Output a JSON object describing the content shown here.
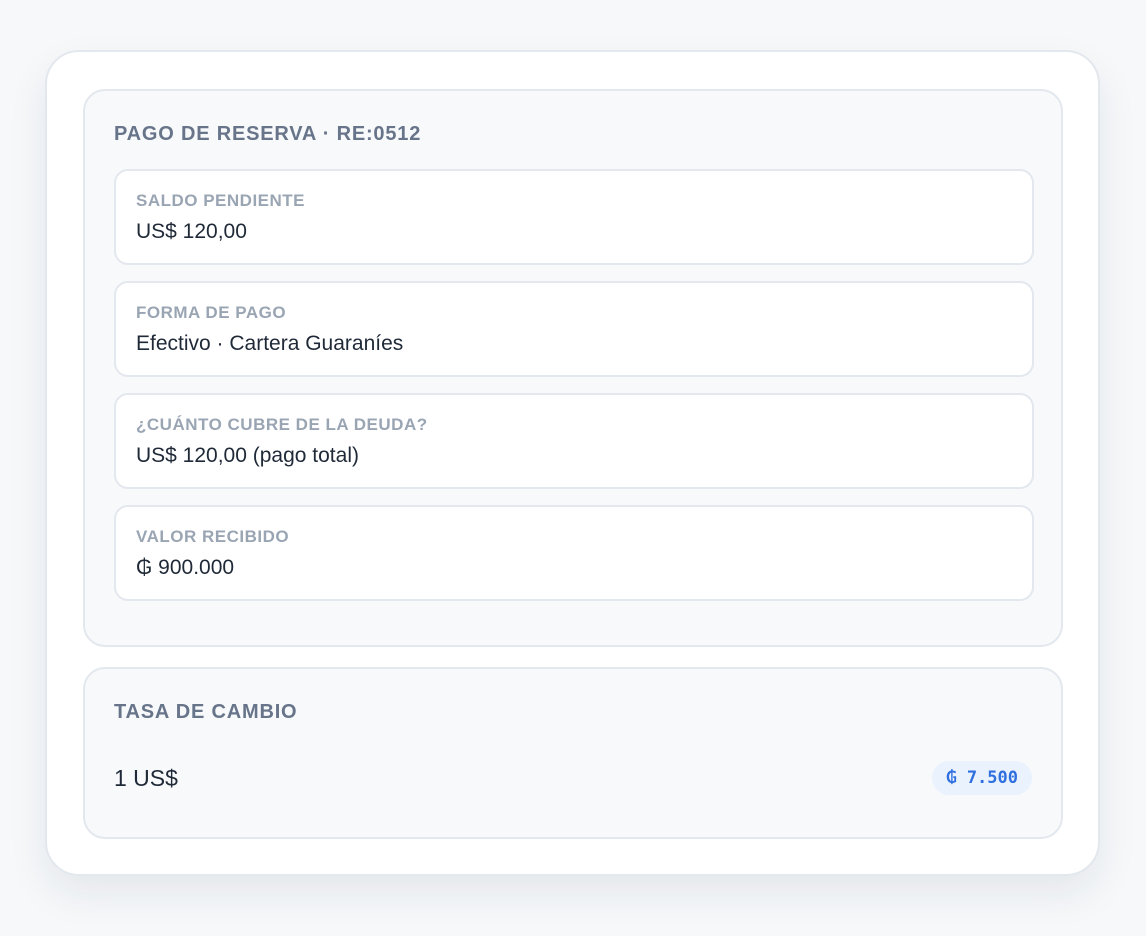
{
  "payment": {
    "title": "PAGO DE RESERVA · RE:0512",
    "fields": [
      {
        "label": "SALDO PENDIENTE",
        "value": "US$ 120,00"
      },
      {
        "label": "FORMA DE PAGO",
        "value": "Efectivo · Cartera Guaraníes"
      },
      {
        "label": "¿CUÁNTO CUBRE DE LA DEUDA?",
        "value": "US$ 120,00 (pago total)"
      },
      {
        "label": "VALOR RECIBIDO",
        "value": "₲ 900.000"
      }
    ]
  },
  "exchange_rate": {
    "title": "TASA DE CAMBIO",
    "base": "1 US$",
    "rate": "₲ 7.500"
  },
  "colors": {
    "page_background": "#f6f8fa",
    "panel_background": "#f7f9fb",
    "title_text": "#677489",
    "label_text": "#9aa5b4",
    "value_text": "#1f2937",
    "badge_background": "#eaf2fe",
    "badge_text": "#2f6fe0"
  }
}
